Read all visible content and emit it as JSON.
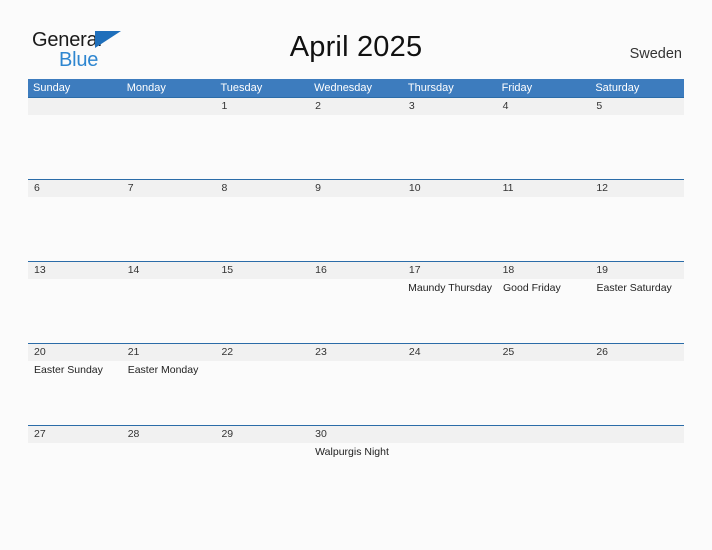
{
  "brand": {
    "name_top": "General",
    "name_bottom": "Blue",
    "color_top": "#1a1a1a",
    "color_bottom": "#2e86d0",
    "triangle_color": "#1f6fbb"
  },
  "header": {
    "title": "April 2025",
    "country": "Sweden"
  },
  "colors": {
    "weekday_header_bg": "#3d7cbe",
    "week_rule": "#2b6ca8",
    "date_band_bg": "#f1f1f1",
    "page_bg": "#fbfbfb",
    "text": "#333333"
  },
  "weekdays": [
    "Sunday",
    "Monday",
    "Tuesday",
    "Wednesday",
    "Thursday",
    "Friday",
    "Saturday"
  ],
  "weeks": [
    {
      "days": [
        {
          "date": "",
          "events": []
        },
        {
          "date": "",
          "events": []
        },
        {
          "date": "1",
          "events": []
        },
        {
          "date": "2",
          "events": []
        },
        {
          "date": "3",
          "events": []
        },
        {
          "date": "4",
          "events": []
        },
        {
          "date": "5",
          "events": []
        }
      ]
    },
    {
      "days": [
        {
          "date": "6",
          "events": []
        },
        {
          "date": "7",
          "events": []
        },
        {
          "date": "8",
          "events": []
        },
        {
          "date": "9",
          "events": []
        },
        {
          "date": "10",
          "events": []
        },
        {
          "date": "11",
          "events": []
        },
        {
          "date": "12",
          "events": []
        }
      ]
    },
    {
      "days": [
        {
          "date": "13",
          "events": []
        },
        {
          "date": "14",
          "events": []
        },
        {
          "date": "15",
          "events": []
        },
        {
          "date": "16",
          "events": []
        },
        {
          "date": "17",
          "events": [
            "Maundy Thursday"
          ]
        },
        {
          "date": "18",
          "events": [
            "Good Friday"
          ]
        },
        {
          "date": "19",
          "events": [
            "Easter Saturday"
          ]
        }
      ]
    },
    {
      "days": [
        {
          "date": "20",
          "events": [
            "Easter Sunday"
          ]
        },
        {
          "date": "21",
          "events": [
            "Easter Monday"
          ]
        },
        {
          "date": "22",
          "events": []
        },
        {
          "date": "23",
          "events": []
        },
        {
          "date": "24",
          "events": []
        },
        {
          "date": "25",
          "events": []
        },
        {
          "date": "26",
          "events": []
        }
      ]
    },
    {
      "days": [
        {
          "date": "27",
          "events": []
        },
        {
          "date": "28",
          "events": []
        },
        {
          "date": "29",
          "events": []
        },
        {
          "date": "30",
          "events": [
            "Walpurgis Night"
          ]
        },
        {
          "date": "",
          "events": []
        },
        {
          "date": "",
          "events": []
        },
        {
          "date": "",
          "events": []
        }
      ]
    }
  ]
}
